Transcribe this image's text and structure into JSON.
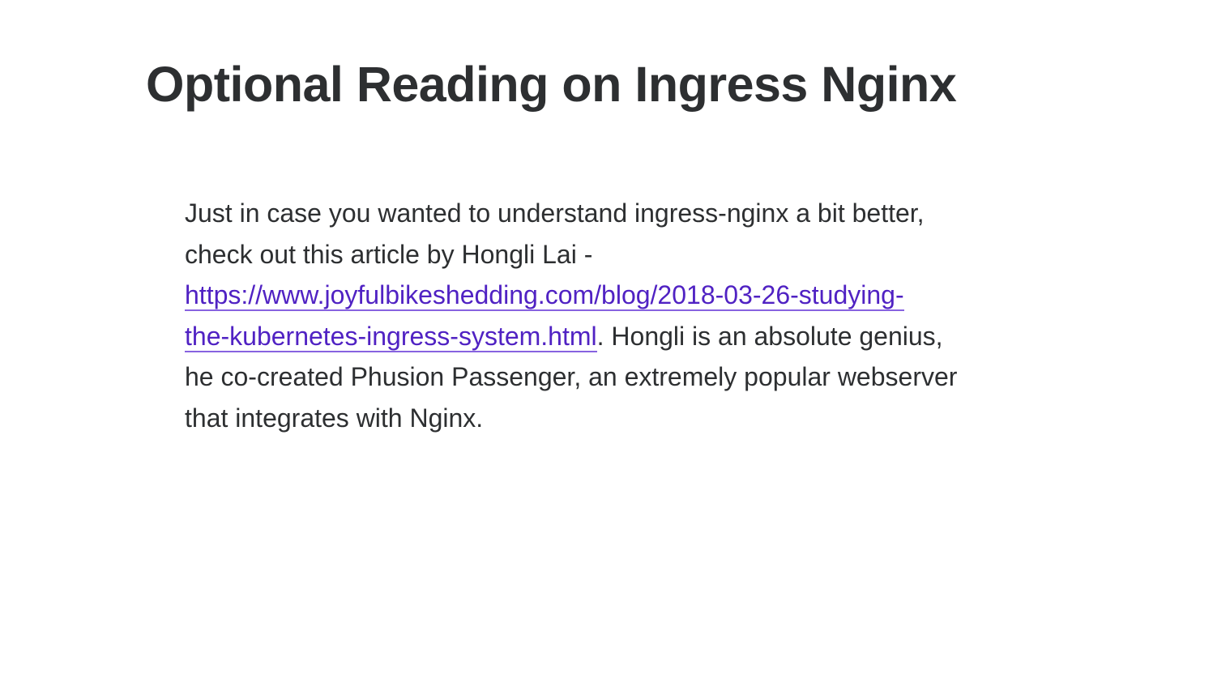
{
  "lecture": {
    "title": "Optional Reading on Ingress Nginx"
  },
  "article": {
    "intro_line1": "Just in case you wanted to understand ingress-nginx a bit better,",
    "intro_line2": "check out this article by Hongli Lai -",
    "link_part1": "https://www.joyfulbikeshedding.com/blog/2018-03-26-studying-",
    "link_part2": "the-kubernetes-ingress-system.html",
    "after_link": ".  Hongli is an absolute genius,",
    "line5": "he co-created Phusion Passenger, an extremely popular webserver",
    "line6": "that integrates with Nginx."
  },
  "colors": {
    "text": "#2d2f31",
    "link": "#5022c3",
    "link_underline": "#8763e0",
    "background": "#ffffff"
  }
}
